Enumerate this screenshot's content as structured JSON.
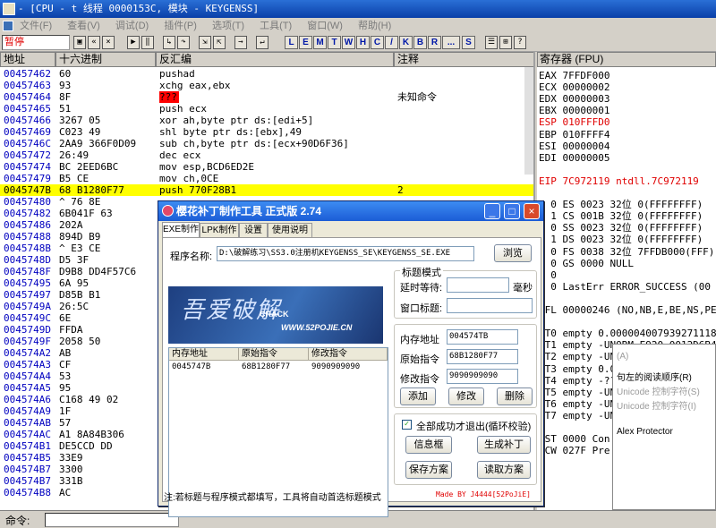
{
  "window": {
    "title": "- [CPU - t 线程 0000153C, 模块 - KEYGENSS]"
  },
  "menu": [
    "文件(F)",
    "查看(V)",
    "调试(D)",
    "插件(P)",
    "选项(T)",
    "工具(T)",
    "窗口(W)",
    "帮助(H)"
  ],
  "toolbar": {
    "status": "暂停",
    "letters": [
      "L",
      "E",
      "M",
      "T",
      "W",
      "H",
      "C",
      "/",
      "K",
      "B",
      "R",
      "...",
      "S"
    ]
  },
  "cpu": {
    "headers": {
      "address": "地址",
      "hex": "十六进制",
      "disasm": "反汇编",
      "comment": "注释"
    },
    "rows": [
      {
        "addr": "00457462",
        "hex": "60",
        "dis": "pushad",
        "cmt": ""
      },
      {
        "addr": "00457463",
        "hex": "93",
        "dis": "xchg eax,ebx",
        "cmt": ""
      },
      {
        "addr": "00457464",
        "hex": "8F",
        "dis": "???",
        "cmt": "未知命令"
      },
      {
        "addr": "00457465",
        "hex": "51",
        "dis": "push ecx",
        "cmt": ""
      },
      {
        "addr": "00457466",
        "hex": "3267 05",
        "dis": "xor ah,byte ptr ds:[edi+5]",
        "cmt": ""
      },
      {
        "addr": "00457469",
        "hex": "C023 49",
        "dis": "shl byte ptr ds:[ebx],49",
        "cmt": ""
      },
      {
        "addr": "0045746C",
        "hex": "2AA9 366F0D09",
        "dis": "sub ch,byte ptr ds:[ecx+90D6F36]",
        "cmt": ""
      },
      {
        "addr": "00457472",
        "hex": "26:49",
        "dis": "dec ecx",
        "cmt": ""
      },
      {
        "addr": "00457474",
        "hex": "BC 2EED6BC",
        "dis": "mov esp,BCD6ED2E",
        "cmt": ""
      },
      {
        "addr": "00457479",
        "hex": "B5 CE",
        "dis": "mov ch,0CE",
        "cmt": ""
      },
      {
        "addr": "0045747B",
        "hex": "68 B1280F77",
        "dis": "push 770F28B1",
        "cmt": "2"
      },
      {
        "addr": "00457480",
        "hex": "^ 76 8E",
        "dis": "",
        "cmt": ""
      },
      {
        "addr": "00457482",
        "hex": "6B041F 63",
        "dis": "",
        "cmt": ""
      },
      {
        "addr": "00457486",
        "hex": "202A",
        "dis": "",
        "cmt": ""
      },
      {
        "addr": "00457488",
        "hex": "894D B9",
        "dis": "",
        "cmt": ""
      },
      {
        "addr": "0045748B",
        "hex": "^ E3 CE",
        "dis": "",
        "cmt": ""
      },
      {
        "addr": "0045748D",
        "hex": "D5 3F",
        "dis": "",
        "cmt": ""
      },
      {
        "addr": "0045748F",
        "hex": "D9B8 DD4F57C6",
        "dis": "",
        "cmt": ""
      },
      {
        "addr": "00457495",
        "hex": "6A 95",
        "dis": "",
        "cmt": ""
      },
      {
        "addr": "00457497",
        "hex": "D85B B1",
        "dis": "",
        "cmt": ""
      },
      {
        "addr": "0045749A",
        "hex": "26:5C",
        "dis": "",
        "cmt": ""
      },
      {
        "addr": "0045749C",
        "hex": "6E",
        "dis": "",
        "cmt": ""
      },
      {
        "addr": "0045749D",
        "hex": "FFDA",
        "dis": "",
        "cmt": ""
      },
      {
        "addr": "0045749F",
        "hex": "2058 50",
        "dis": "",
        "cmt": ""
      },
      {
        "addr": "004574A2",
        "hex": "AB",
        "dis": "",
        "cmt": ""
      },
      {
        "addr": "004574A3",
        "hex": "CF",
        "dis": "",
        "cmt": ""
      },
      {
        "addr": "004574A4",
        "hex": "53",
        "dis": "",
        "cmt": ""
      },
      {
        "addr": "004574A5",
        "hex": "95",
        "dis": "",
        "cmt": ""
      },
      {
        "addr": "004574A6",
        "hex": "C168 49 02",
        "dis": "",
        "cmt": ""
      },
      {
        "addr": "004574A9",
        "hex": "1F",
        "dis": "",
        "cmt": ""
      },
      {
        "addr": "004574AB",
        "hex": "57",
        "dis": "",
        "cmt": ""
      },
      {
        "addr": "004574AC",
        "hex": "A1 8A84B306",
        "dis": "",
        "cmt": ""
      },
      {
        "addr": "004574B1",
        "hex": "DE5CCD DD",
        "dis": "",
        "cmt": ""
      },
      {
        "addr": "004574B5",
        "hex": "33E9",
        "dis": "",
        "cmt": ""
      },
      {
        "addr": "004574B7",
        "hex": "3300",
        "dis": "",
        "cmt": ""
      },
      {
        "addr": "004574B7",
        "hex": "331B",
        "dis": "",
        "cmt": ""
      },
      {
        "addr": "004574B8",
        "hex": "AC",
        "dis": "",
        "cmt": ""
      }
    ]
  },
  "registers": {
    "header": "寄存器 (FPU)",
    "lines": [
      {
        "t": "EAX 7FFDF000",
        "hi": false
      },
      {
        "t": "ECX 00000002",
        "hi": false
      },
      {
        "t": "EDX 00000003",
        "hi": false
      },
      {
        "t": "EBX 00000001",
        "hi": false
      },
      {
        "t": "ESP 010FFFD0",
        "hi": true
      },
      {
        "t": "EBP 010FFFF4",
        "hi": false
      },
      {
        "t": "ESI 00000004",
        "hi": false
      },
      {
        "t": "EDI 00000005",
        "hi": false
      },
      {
        "t": "",
        "hi": false
      },
      {
        "t": "EIP 7C972119 ntdll.7C972119",
        "hi": true
      },
      {
        "t": "",
        "hi": false
      },
      {
        "t": "C 0  ES 0023 32位 0(FFFFFFFF)",
        "hi": false
      },
      {
        "t": "P 1  CS 001B 32位 0(FFFFFFFF)",
        "hi": false
      },
      {
        "t": "A 0  SS 0023 32位 0(FFFFFFFF)",
        "hi": false
      },
      {
        "t": "Z 1  DS 0023 32位 0(FFFFFFFF)",
        "hi": false
      },
      {
        "t": "S 0  FS 0038 32位 7FFDB000(FFF)",
        "hi": false
      },
      {
        "t": "T 0  GS 0000 NULL",
        "hi": false
      },
      {
        "t": "D 0",
        "hi": false
      },
      {
        "t": "O 0  LastErr ERROR_SUCCESS (00",
        "hi": false
      },
      {
        "t": "",
        "hi": false
      },
      {
        "t": "EFL 00000246 (NO,NB,E,BE,NS,PE",
        "hi": false
      },
      {
        "t": "",
        "hi": false
      },
      {
        "t": "ST0 empty 0.0000040079392711189",
        "hi": false
      },
      {
        "t": "ST1 empty -UNORM E920 0012D6B4",
        "hi": false
      },
      {
        "t": "ST2 empty -UNORM 8ECB 7C9301DB",
        "hi": false
      },
      {
        "t": "ST3 empty 0.0",
        "hi": false
      },
      {
        "t": "ST4 empty -??",
        "hi": false
      },
      {
        "t": "ST5 empty -UN",
        "hi": false
      },
      {
        "t": "ST6 empty -UN",
        "hi": false
      },
      {
        "t": "ST7 empty -UN",
        "hi": false
      },
      {
        "t": "",
        "hi": false
      },
      {
        "t": "FST 0000  Con",
        "hi": false
      },
      {
        "t": "FCW 027F  Pre",
        "hi": false
      }
    ]
  },
  "context_menu": {
    "items": [
      "(A)",
      "句左的阅读顺序(R)",
      "Unicode 控制字符(S)",
      "Unicode 控制字符(I)",
      "Alex Protector"
    ]
  },
  "command": {
    "label": "命令:"
  },
  "dialog": {
    "title": "樱花补丁制作工具  正式版  2.74",
    "tabs": [
      "EXE制作",
      "LPK制作",
      "设置",
      "使用说明"
    ],
    "program_label": "程序名称:",
    "program_path": "D:\\破解练习\\SS3.0注册机KEYGENSS_SE\\KEYGENSS_SE.EXE",
    "browse": "浏览",
    "banner": {
      "main": "吾爱破解",
      "crack": "CRACK",
      "site": "WWW.52POJIE.CN"
    },
    "table": {
      "headers": [
        "内存地址",
        "原始指令",
        "修改指令"
      ],
      "row": [
        "0045747B",
        "68B1280F77",
        "9090909090"
      ]
    },
    "title_mode": {
      "group": "标题模式",
      "delay_label": "延时等待:",
      "delay_value": "",
      "delay_unit": "毫秒",
      "window_label": "窗口标题:",
      "window_value": ""
    },
    "edit": {
      "mem_label": "内存地址",
      "mem_value": "004574TB",
      "orig_label": "原始指令",
      "orig_value": "68B1280F77",
      "mod_label": "修改指令",
      "mod_value": "9090909090",
      "add": "添加",
      "modify": "修改",
      "delete": "删除"
    },
    "options": {
      "exit_check": "全部成功才退出(循环校验)",
      "info_box": "信息框",
      "generate": "生成补丁",
      "save": "保存方案",
      "load": "读取方案"
    },
    "note": "注:若标题与程序模式都填写，工具将自动首选标题模式",
    "made_by": "Made BY J4444[52PoJiE]"
  }
}
